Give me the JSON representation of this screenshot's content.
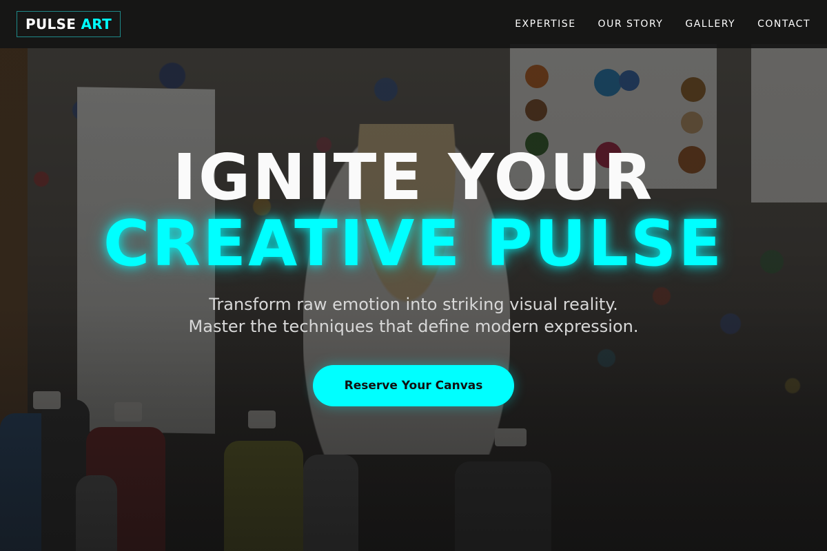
{
  "header": {
    "logo_part1": "PULSE",
    "logo_part2": "ART",
    "nav": [
      {
        "label": "EXPERTISE"
      },
      {
        "label": "OUR STORY"
      },
      {
        "label": "GALLERY"
      },
      {
        "label": "CONTACT"
      }
    ]
  },
  "hero": {
    "headline_line1": "IGNITE YOUR",
    "headline_line2": "CREATIVE PULSE",
    "subtitle_line1": "Transform raw emotion into striking visual reality.",
    "subtitle_line2": "Master the techniques that define modern expression.",
    "cta_label": "Reserve Your Canvas"
  },
  "colors": {
    "accent": "#00ffff",
    "header_bg": "#141414",
    "text": "#ffffff"
  }
}
